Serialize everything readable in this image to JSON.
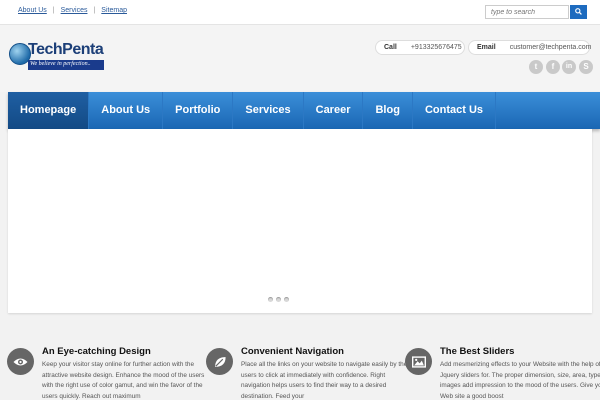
{
  "topbar": {
    "links": [
      "About Us",
      "Services",
      "Sitemap"
    ],
    "separator": "|",
    "search_placeholder": "type to search"
  },
  "header": {
    "logo_text": "TechPenta",
    "tagline": "We believe in perfection..",
    "call_label": "Call",
    "call_value": "+913325676475",
    "email_label": "Email",
    "email_value": "customer@techpenta.com",
    "social": [
      {
        "icon": "twitter-icon",
        "glyph": "t"
      },
      {
        "icon": "facebook-icon",
        "glyph": "f"
      },
      {
        "icon": "linkedin-icon",
        "glyph": "in"
      },
      {
        "icon": "skype-icon",
        "glyph": "S"
      }
    ]
  },
  "nav": {
    "items": [
      "Homepage",
      "About Us",
      "Portfolio",
      "Services",
      "Career",
      "Blog",
      "Contact Us"
    ],
    "active_index": 0
  },
  "slider": {
    "dots": 3
  },
  "features": [
    {
      "icon": "eye-icon",
      "title": "An Eye-catching Design",
      "text": "Keep your visitor stay online for further action with the attractive website design. Enhance the mood of the  users with the right use of color gamut, and win the favor of the users quickly. Reach out maximum"
    },
    {
      "icon": "leaf-icon",
      "title": "Convenient Navigation",
      "text": "Place all the links on your website to navigate easily by the users to click at immediately with confidence.   Right navigation helps users to find their way to a desired destination. Feed your"
    },
    {
      "icon": "image-icon",
      "title": "The Best Sliders",
      "text": "Add mesmerizing effects to your Website with the help of Jquery  sliders for. The proper dimension, size, area, type of images add impression to the mood of the users. Give your Web site a good boost"
    }
  ],
  "colors": {
    "accent": "#1d6bbf",
    "nav_active": "#134a85"
  }
}
